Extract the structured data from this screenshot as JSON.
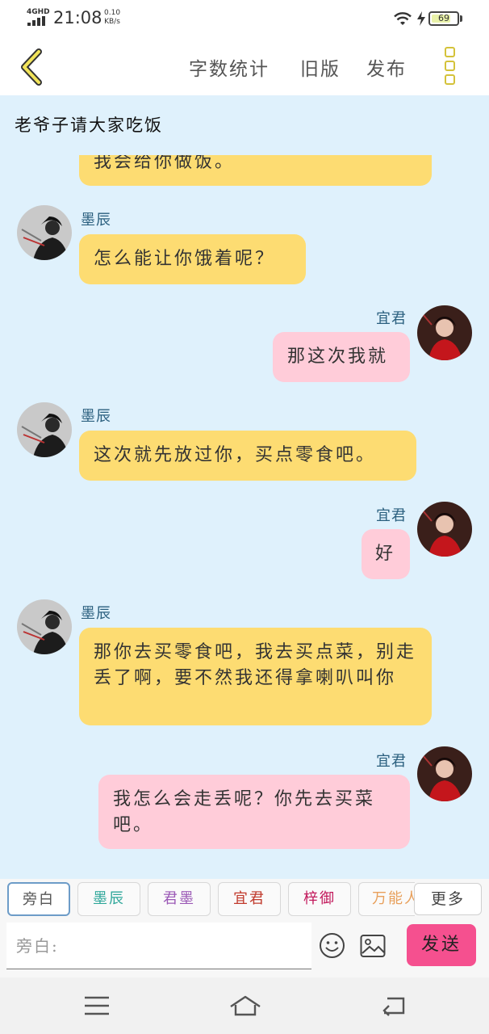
{
  "status_bar": {
    "network": "4GHD",
    "time": "21:08",
    "speed_value": "0.10",
    "speed_unit": "KB/s",
    "battery": "69",
    "battery_level": 0.69,
    "icons": [
      "signal-icon",
      "wifi-icon",
      "charging-icon",
      "battery-icon"
    ]
  },
  "header": {
    "back_icon": "chevron-left-icon",
    "word_count": "字数统计",
    "old_version": "旧版",
    "publish": "发布",
    "more_icon": "more-vertical-icon"
  },
  "chat": {
    "title": "老爷子请大家吃饭",
    "messages": [
      {
        "side": "left",
        "speaker": "",
        "text": "我会给你做饭。",
        "color": "yellow",
        "partial": true
      },
      {
        "side": "left",
        "speaker": "墨辰",
        "text": "怎么能让你饿着呢？",
        "color": "yellow"
      },
      {
        "side": "right",
        "speaker": "宜君",
        "text": "那这次我就",
        "color": "pink"
      },
      {
        "side": "left",
        "speaker": "墨辰",
        "text": "这次就先放过你，买点零食吧。",
        "color": "yellow"
      },
      {
        "side": "right",
        "speaker": "宜君",
        "text": "好",
        "color": "pink"
      },
      {
        "side": "left",
        "speaker": "墨辰",
        "text": "那你去买零食吧，我去买点菜，别走丢了啊，要不然我还得拿喇叭叫你",
        "color": "yellow"
      },
      {
        "side": "right",
        "speaker": "宜君",
        "text": "我怎么会走丢呢？你先去买菜吧。",
        "color": "pink"
      }
    ]
  },
  "toolbar": {
    "roles": [
      {
        "label": "旁白",
        "color": "#555555",
        "active": true
      },
      {
        "label": "墨辰",
        "color": "#2fa79a",
        "active": false
      },
      {
        "label": "君墨",
        "color": "#9b59b6",
        "active": false
      },
      {
        "label": "宜君",
        "color": "#c0392b",
        "active": false
      },
      {
        "label": "梓御",
        "color": "#c2185b",
        "active": false
      },
      {
        "label": "万能人",
        "color": "#e8a05c",
        "active": false
      }
    ],
    "more": "更多",
    "input_placeholder": "旁白:",
    "emoji_icon": "emoji-icon",
    "image_icon": "image-icon",
    "send": "发送"
  },
  "nav": {
    "icons": [
      "menu-icon",
      "home-icon",
      "back-icon"
    ]
  },
  "colors": {
    "chat_bg": "#dff1fc",
    "bubble_yellow": "#fddc72",
    "bubble_pink": "#ffccd9",
    "send_button": "#f5508f",
    "accent_icon": "#d4c23a"
  }
}
